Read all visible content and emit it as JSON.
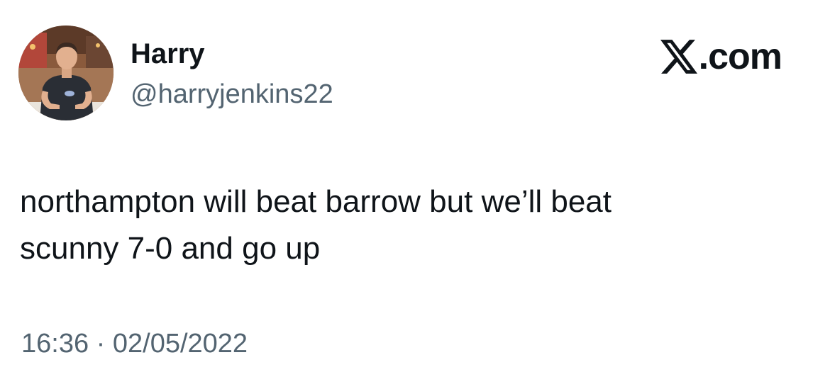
{
  "author": {
    "display_name": "Harry",
    "handle": "@harryjenkins22",
    "avatar_icon": "profile-photo-avatar"
  },
  "brand": {
    "logo_icon": "x-logo-icon",
    "text": ".com",
    "color": "#0f1419"
  },
  "tweet": {
    "lines": [
      "northampton will beat barrow but we’ll beat",
      "scunny 7-0 and go up"
    ],
    "timestamp": "16:36 · 02/05/2022"
  },
  "colors": {
    "text_primary": "#0f1419",
    "text_secondary": "#536471",
    "background": "#ffffff"
  }
}
